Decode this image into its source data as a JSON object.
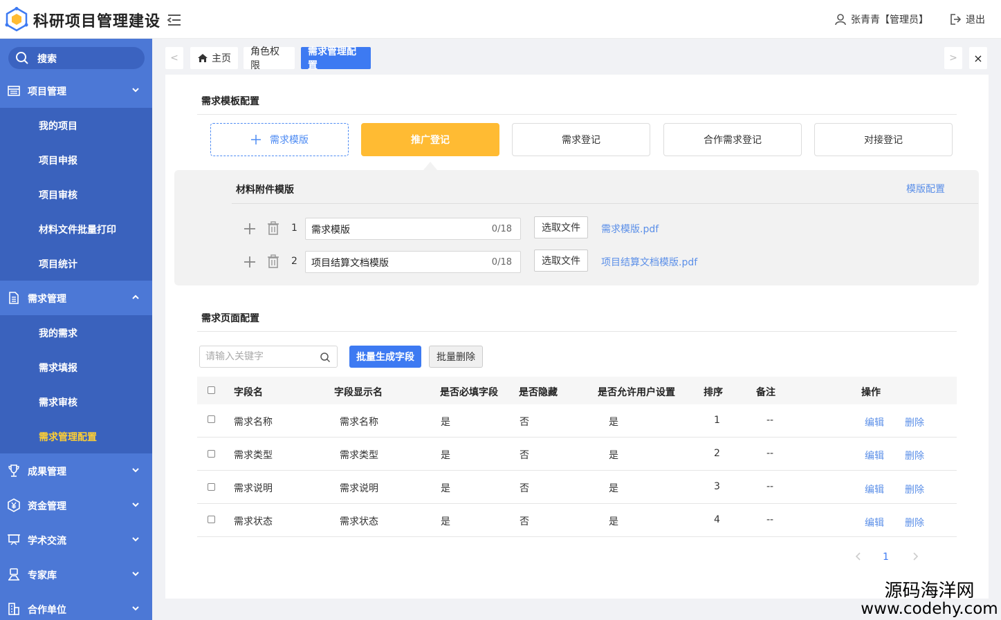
{
  "header": {
    "app_title": "科研项目管理建设",
    "user": "张青青【管理员】",
    "logout": "退出"
  },
  "sidebar": {
    "search_label": "搜索",
    "groups": [
      {
        "label": "项目管理",
        "icon": "project-icon",
        "expanded": true,
        "items": [
          "我的项目",
          "项目申报",
          "项目审核",
          "材料文件批量打印",
          "项目统计"
        ]
      },
      {
        "label": "需求管理",
        "icon": "document-icon",
        "expanded": true,
        "items": [
          "我的需求",
          "需求填报",
          "需求审核",
          "需求管理配置"
        ],
        "active_item": "需求管理配置"
      },
      {
        "label": "成果管理",
        "icon": "trophy-icon",
        "expanded": false
      },
      {
        "label": "资金管理",
        "icon": "yuan-icon",
        "expanded": false
      },
      {
        "label": "学术交流",
        "icon": "presentation-icon",
        "expanded": false
      },
      {
        "label": "专家库",
        "icon": "expert-icon",
        "expanded": false
      },
      {
        "label": "合作单位",
        "icon": "building-icon",
        "expanded": false
      }
    ]
  },
  "tabs": {
    "prev": "<",
    "next": ">",
    "close": "×",
    "items": [
      {
        "label": "主页",
        "icon": "home-icon"
      },
      {
        "label": "角色权限"
      },
      {
        "label": "需求管理配置",
        "active": true
      }
    ]
  },
  "template_config": {
    "title": "需求模板配置",
    "add_button": "需求模版",
    "templates": [
      "推广登记",
      "需求登记",
      "合作需求登记",
      "对接登记"
    ],
    "active_template": "推广登记",
    "attachments": {
      "title": "材料附件模版",
      "config_link": "模版配置",
      "rows": [
        {
          "num": "1",
          "name": "需求模版",
          "count": "0/18",
          "pick_label": "选取文件",
          "file": "需求模版.pdf"
        },
        {
          "num": "2",
          "name": "项目结算文档模版",
          "count": "0/18",
          "pick_label": "选取文件",
          "file": "项目结算文档模版.pdf"
        }
      ]
    }
  },
  "page_config": {
    "title": "需求页面配置",
    "search_placeholder": "请输入关键字",
    "batch_generate": "批量生成字段",
    "batch_delete": "批量删除",
    "columns": [
      "字段名",
      "字段显示名",
      "是否必填字段",
      "是否隐藏",
      "是否允许用户设置",
      "排序",
      "备注",
      "操作"
    ],
    "rows": [
      {
        "field": "需求名称",
        "display": "需求名称",
        "required": "是",
        "hidden": "否",
        "user_set": "是",
        "order": "1",
        "remark": "--",
        "edit": "编辑",
        "delete": "删除"
      },
      {
        "field": "需求类型",
        "display": "需求类型",
        "required": "是",
        "hidden": "否",
        "user_set": "是",
        "order": "2",
        "remark": "--",
        "edit": "编辑",
        "delete": "删除"
      },
      {
        "field": "需求说明",
        "display": "需求说明",
        "required": "是",
        "hidden": "否",
        "user_set": "是",
        "order": "3",
        "remark": "--",
        "edit": "编辑",
        "delete": "删除"
      },
      {
        "field": "需求状态",
        "display": "需求状态",
        "required": "是",
        "hidden": "否",
        "user_set": "是",
        "order": "4",
        "remark": "--",
        "edit": "编辑",
        "delete": "删除"
      }
    ],
    "pagination": {
      "current": "1"
    }
  },
  "watermark": {
    "line1": "源码海洋网",
    "line2": "www.codehy.com"
  },
  "colors": {
    "sidebar": "#4c78d6",
    "submenu": "#3a62bd",
    "accent": "#3d7af2",
    "active_template": "#ffbb33",
    "active_menu_text": "#ffcf33",
    "link": "#5b8fe8"
  }
}
